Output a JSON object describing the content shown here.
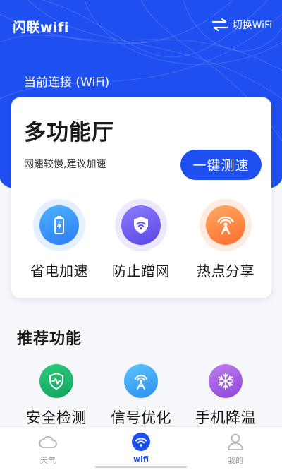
{
  "header": {
    "app_title": "闪联wifi",
    "switch_label": "切换WiFi",
    "switch_icon": "swap-arrows-icon",
    "connection_label": "当前连接 (WiFi)"
  },
  "card": {
    "title": "多功能厅",
    "subtitle": "网速较慢,建议加速",
    "boost_button": "一键测速",
    "features": [
      {
        "label": "省电加速",
        "icon": "battery-icon",
        "color": "#2a7cf5"
      },
      {
        "label": "防止蹭网",
        "icon": "shield-wifi-icon",
        "color": "#5a46e6"
      },
      {
        "label": "热点分享",
        "icon": "hotspot-icon",
        "color": "#ff6c2c"
      }
    ]
  },
  "recommended": {
    "title": "推荐功能",
    "items": [
      {
        "label": "安全检测",
        "icon": "shield-pulse-icon",
        "color": "#0fa35c"
      },
      {
        "label": "信号优化",
        "icon": "signal-tower-icon",
        "color": "#2c8ff0"
      },
      {
        "label": "手机降温",
        "icon": "snowflake-icon",
        "color": "#8e47d9"
      }
    ]
  },
  "tabbar": {
    "tabs": [
      {
        "label": "天气",
        "icon": "cloud-icon",
        "active": false
      },
      {
        "label": "wifi",
        "icon": "wifi-icon",
        "active": true
      },
      {
        "label": "我的",
        "icon": "user-icon",
        "active": false
      }
    ]
  },
  "colors": {
    "primary": "#1e4ff0",
    "background": "#f6f7fb"
  }
}
